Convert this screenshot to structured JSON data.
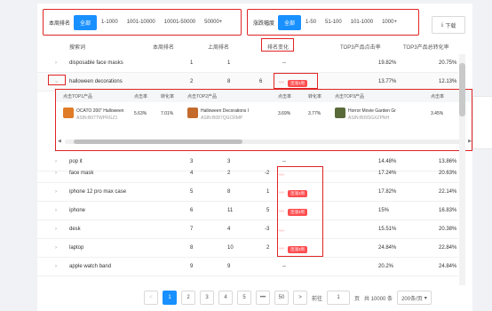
{
  "filters": {
    "rank_label": "本周排名",
    "rank_options": [
      "全部",
      "1-1000",
      "1001-10000",
      "10001-50000",
      "50000+"
    ],
    "change_label": "涨跌幅度",
    "change_options": [
      "全部",
      "1-50",
      "51-100",
      "101-1000",
      "1000+"
    ],
    "download_label": "下载",
    "download_icon": "download-icon"
  },
  "table": {
    "headers": {
      "search_term": "搜索词",
      "week_rank": "本周排名",
      "last_week_rank": "上周排名",
      "rank_change": "排名变化",
      "top3_click_share": "TOP3产品点击率",
      "top3_conv_share": "TOP3产品总转化率"
    },
    "hot_badge": "连涨3周",
    "rows": [
      {
        "term": "disposable face masks",
        "rank": "1",
        "last": "1",
        "change": "--",
        "trend": false,
        "hot": false,
        "click": "19.82%",
        "conv": "20.75%"
      },
      {
        "term": "halloween decorations",
        "rank": "2",
        "last": "8",
        "change": "6",
        "trend": true,
        "hot": true,
        "click": "13.77%",
        "conv": "12.13%"
      },
      {
        "term": "pop it",
        "rank": "3",
        "last": "3",
        "change": "--",
        "trend": false,
        "hot": false,
        "click": "14.48%",
        "conv": "13.86%"
      },
      {
        "term": "face mask",
        "rank": "4",
        "last": "2",
        "change": "-2",
        "trend": true,
        "hot": false,
        "click": "17.24%",
        "conv": "20.63%"
      },
      {
        "term": "iphone 12 pro max case",
        "rank": "5",
        "last": "8",
        "change": "1",
        "trend": true,
        "hot": true,
        "click": "17.82%",
        "conv": "22.14%"
      },
      {
        "term": "iphone",
        "rank": "6",
        "last": "11",
        "change": "5",
        "trend": true,
        "hot": true,
        "click": "15%",
        "conv": "16.83%"
      },
      {
        "term": "desk",
        "rank": "7",
        "last": "4",
        "change": "-3",
        "trend": true,
        "hot": false,
        "click": "15.51%",
        "conv": "20.38%"
      },
      {
        "term": "laptop",
        "rank": "8",
        "last": "10",
        "change": "2",
        "trend": true,
        "hot": true,
        "click": "24.84%",
        "conv": "22.84%"
      },
      {
        "term": "apple watch band",
        "rank": "9",
        "last": "9",
        "change": "--",
        "trend": false,
        "hot": false,
        "click": "20.2%",
        "conv": "24.84%"
      }
    ]
  },
  "expanded": {
    "headers": [
      "点击TOP1产品",
      "点击率",
      "转化率",
      "点击TOP2产品",
      "点击率",
      "转化率",
      "点击TOP3产品",
      "点击率"
    ],
    "products": [
      {
        "name": "OCATO 200\" Halloween",
        "asin": "ASIN:B07TWPRGZ1",
        "click": "5.63%",
        "conv": "7.01%",
        "color": "#e07b27"
      },
      {
        "name": "Halloween Decorations I",
        "asin": "ASIN:B087QGCRMP",
        "click": "3.69%",
        "conv": "3.77%",
        "color": "#c46b2c"
      },
      {
        "name": "Horror Movie Garden Gr",
        "asin": "ASIN:B09SGXZPNH",
        "click": "3.45%",
        "conv": "",
        "color": "#5a6b3a"
      }
    ]
  },
  "pager": {
    "prev": "<",
    "pages": [
      "1",
      "2",
      "3",
      "4",
      "5",
      "•••",
      "50"
    ],
    "active": "1",
    "next": ">",
    "goto_label": "前往",
    "goto_value": "1",
    "page_unit": "页",
    "total": "共 10000 条",
    "page_size": "200条/页"
  }
}
